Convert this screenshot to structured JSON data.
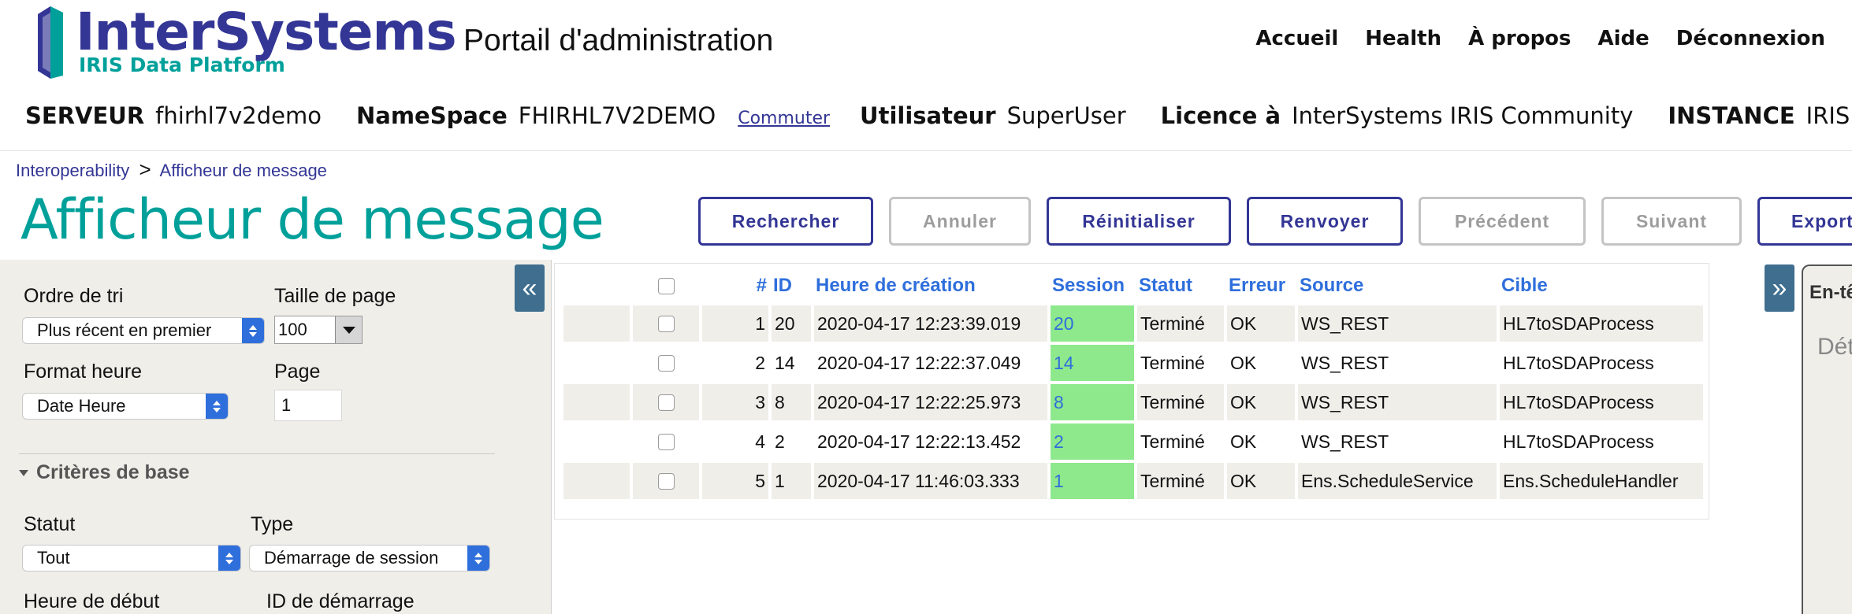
{
  "brand": {
    "name": "InterSystems",
    "tm": "™",
    "product": "IRIS Data Platform"
  },
  "portal_title": "Portail d'administration",
  "topnav": [
    "Accueil",
    "Health",
    "À propos",
    "Aide",
    "Déconnexion"
  ],
  "info": {
    "server_label": "SERVEUR",
    "server": "fhirhl7v2demo",
    "namespace_label": "NameSpace",
    "namespace": "FHIRHL7V2DEMO",
    "switch": "Commuter",
    "user_label": "Utilisateur",
    "user": "SuperUser",
    "license_label": "Licence à",
    "license": "InterSystems IRIS Community",
    "instance_label": "INSTANCE",
    "instance": "IRIS"
  },
  "breadcrumb": {
    "parent": "Interoperability",
    "sep": ">",
    "current": "Afficheur de message"
  },
  "page_title": "Afficheur de message",
  "toolbar": {
    "search": "Rechercher",
    "cancel": "Annuler",
    "reset": "Réinitialiser",
    "resend": "Renvoyer",
    "previous": "Précédent",
    "next": "Suivant",
    "export": "Exporter"
  },
  "collapse_left": "«",
  "collapse_right": "»",
  "filters": {
    "sort_label": "Ordre de tri",
    "sort_value": "Plus récent en premier",
    "pagesize_label": "Taille de page",
    "pagesize_value": "100",
    "timeformat_label": "Format heure",
    "timeformat_value": "Date Heure",
    "page_label": "Page",
    "page_value": "1",
    "section_label": "Critères de base",
    "status_label": "Statut",
    "status_value": "Tout",
    "type_label": "Type",
    "type_value": "Démarrage de session",
    "start_time_label": "Heure de début",
    "start_id_label": "ID de démarrage"
  },
  "table": {
    "headers": [
      "#",
      "ID",
      "Heure de création",
      "Session",
      "Statut",
      "Erreur",
      "Source",
      "Cible"
    ],
    "rows": [
      {
        "n": "1",
        "id": "20",
        "time": "2020-04-17 12:23:39.019",
        "session": "20",
        "status": "Terminé",
        "error": "OK",
        "source": "WS_REST",
        "target": "HL7toSDAProcess"
      },
      {
        "n": "2",
        "id": "14",
        "time": "2020-04-17 12:22:37.049",
        "session": "14",
        "status": "Terminé",
        "error": "OK",
        "source": "WS_REST",
        "target": "HL7toSDAProcess"
      },
      {
        "n": "3",
        "id": "8",
        "time": "2020-04-17 12:22:25.973",
        "session": "8",
        "status": "Terminé",
        "error": "OK",
        "source": "WS_REST",
        "target": "HL7toSDAProcess"
      },
      {
        "n": "4",
        "id": "2",
        "time": "2020-04-17 12:22:13.452",
        "session": "2",
        "status": "Terminé",
        "error": "OK",
        "source": "WS_REST",
        "target": "HL7toSDAProcess"
      },
      {
        "n": "5",
        "id": "1",
        "time": "2020-04-17 11:46:03.333",
        "session": "1",
        "status": "Terminé",
        "error": "OK",
        "source": "Ens.ScheduleService",
        "target": "Ens.ScheduleHandler"
      }
    ]
  },
  "details": {
    "tab": "En-tête",
    "placeholder": "Détails"
  },
  "colors": {
    "brand": "#333695",
    "accent": "#00a09a",
    "session_bg": "#8ee88c",
    "link": "#2f6fdc"
  }
}
